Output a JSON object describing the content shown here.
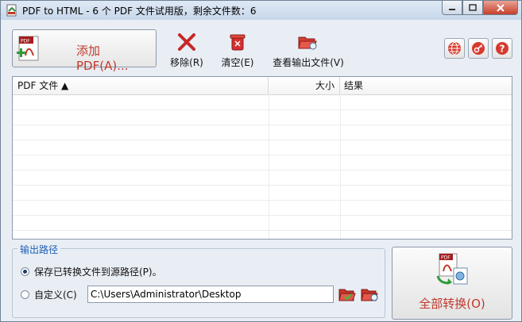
{
  "window": {
    "title": "PDF to HTML - 6 个 PDF 文件试用版，剩余文件数：6"
  },
  "toolbar": {
    "add_label": "添加 PDF(A)...",
    "remove_label": "移除(R)",
    "clear_label": "清空(E)",
    "view_output_label": "查看输出文件(V)"
  },
  "file_list": {
    "columns": [
      "PDF 文件 ▲",
      "大小",
      "结果"
    ],
    "rows": []
  },
  "output": {
    "legend": "输出路径",
    "option_source": "保存已转换文件到源路径(P)。",
    "option_custom": "自定义(C)",
    "path_value": "C:\\Users\\Administrator\\Desktop",
    "selected": "source"
  },
  "convert_all_label": "全部转换(O)",
  "colors": {
    "accent_text": "#c0392b",
    "legend_blue": "#1f5fb4",
    "chrome": "#e9eef5"
  }
}
